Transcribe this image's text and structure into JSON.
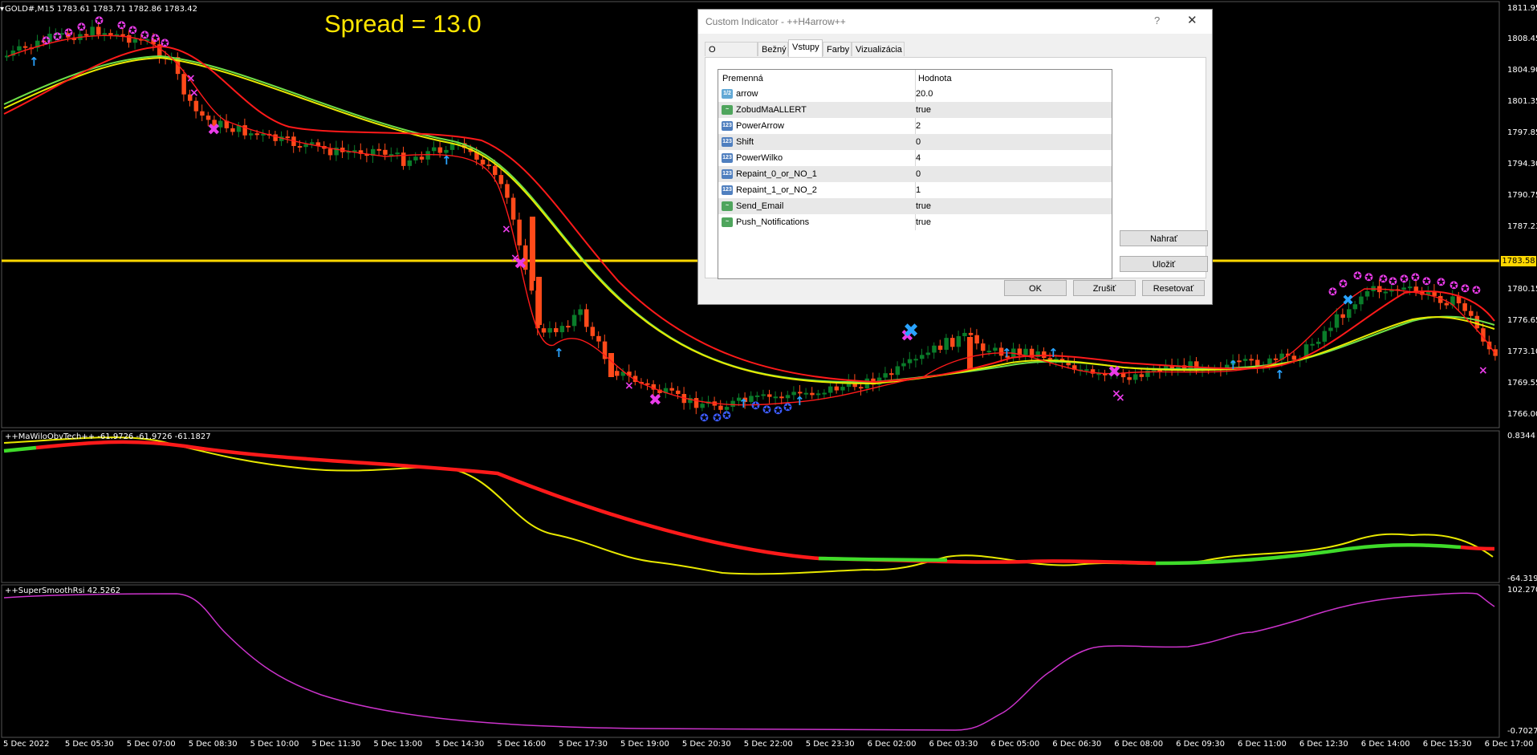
{
  "chart": {
    "title": "GOLD#,M15  1783.61 1783.71 1782.86 1783.42",
    "spread": "Spread = 13.0",
    "bid_price": "1783.58",
    "price_ticks": [
      "1811.95",
      "1808.45",
      "1804.90",
      "1801.35",
      "1797.85",
      "1794.30",
      "1790.75",
      "1787.23",
      "1780.15",
      "1776.65",
      "1773.10",
      "1769.55",
      "1766.00"
    ],
    "time_ticks": [
      "5 Dec 2022",
      "5 Dec 05:30",
      "5 Dec 07:00",
      "5 Dec 08:30",
      "5 Dec 10:00",
      "5 Dec 11:30",
      "5 Dec 13:00",
      "5 Dec 14:30",
      "5 Dec 16:00",
      "5 Dec 17:30",
      "5 Dec 19:00",
      "5 Dec 20:30",
      "5 Dec 22:00",
      "5 Dec 23:30",
      "6 Dec 02:00",
      "6 Dec 03:30",
      "6 Dec 05:00",
      "6 Dec 06:30",
      "6 Dec 08:00",
      "6 Dec 09:30",
      "6 Dec 11:00",
      "6 Dec 12:30",
      "6 Dec 14:00",
      "6 Dec 15:30",
      "6 Dec 17:00"
    ],
    "colors": {
      "bull": "#0a7d2a",
      "bear": "#ff4a1a",
      "bid_line": "#ffd700",
      "ma_red": "#ff1a1a",
      "ma_yellow": "#e8e800",
      "ma_green": "#4cd13a",
      "rsi": "#cc33cc",
      "arrow_up": "#29a3ff",
      "cross": "#e83be8"
    }
  },
  "indicator1": {
    "label": "++MaWiloObvTech++  -61.9726 -61.9726 -61.1827",
    "top_value": "0.8344",
    "bottom_value": "-64.319"
  },
  "indicator2": {
    "label": "++SuperSmoothRsi 42.5262",
    "top_value": "102.2707",
    "bottom_value": "-0.7027"
  },
  "dialog": {
    "title": "Custom Indicator - ++H4arrow++",
    "help": "?",
    "close": "✕",
    "tabs": [
      "O programe",
      "Bežný",
      "Vstupy",
      "Farby",
      "Vizualizácia"
    ],
    "active_tab": "Vstupy",
    "columns": [
      "Premenná",
      "Hodnota"
    ],
    "params": [
      {
        "icon": "dbl",
        "label": "1/2",
        "name": "arrow",
        "value": "20.0"
      },
      {
        "icon": "bool",
        "label": "~",
        "name": "ZobudMaALLERT",
        "value": "true"
      },
      {
        "icon": "num",
        "label": "123",
        "name": "PowerArrow",
        "value": "2"
      },
      {
        "icon": "num",
        "label": "123",
        "name": "Shift",
        "value": "0"
      },
      {
        "icon": "num",
        "label": "123",
        "name": "PowerWilko",
        "value": "4"
      },
      {
        "icon": "num",
        "label": "123",
        "name": "Repaint_0_or_NO_1",
        "value": "0"
      },
      {
        "icon": "num",
        "label": "123",
        "name": "Repaint_1_or_NO_2",
        "value": "1"
      },
      {
        "icon": "bool",
        "label": "~",
        "name": "Send_Email",
        "value": "true"
      },
      {
        "icon": "bool",
        "label": "~",
        "name": "Push_Notifications",
        "value": "true"
      }
    ],
    "buttons": {
      "load": "Nahrať",
      "save": "Uložiť",
      "ok": "OK",
      "cancel": "Zrušiť",
      "reset": "Resetovať"
    }
  }
}
